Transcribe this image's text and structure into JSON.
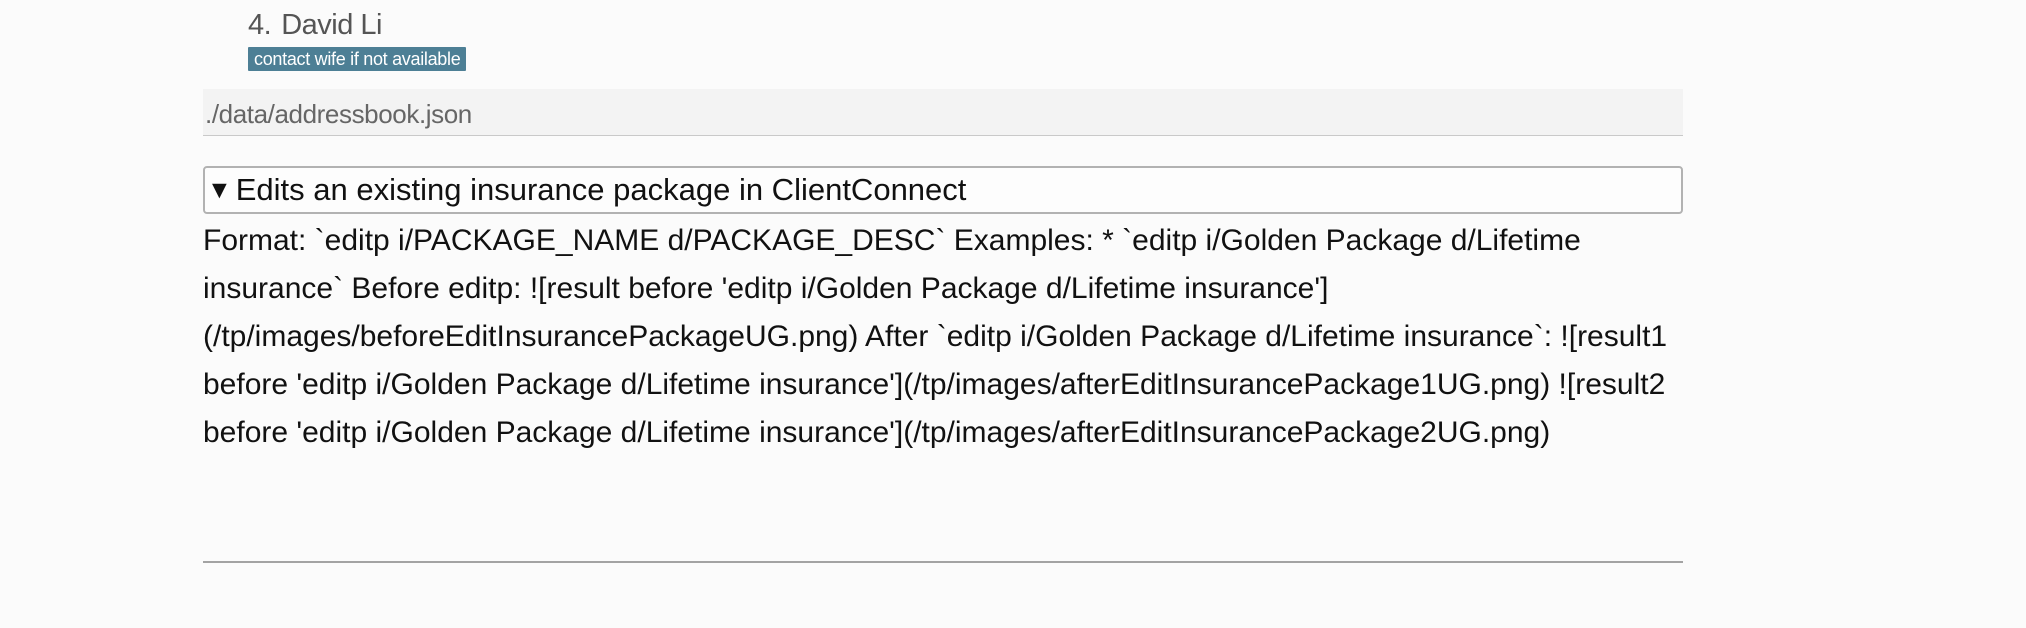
{
  "contact": {
    "number": "4.",
    "name": "David Li",
    "tag": "contact wife if not available"
  },
  "file": {
    "path": "./data/addressbook.json"
  },
  "section": {
    "toggle_icon": "▼",
    "title": "Edits an existing insurance package in ClientConnect",
    "body": "Format: `editp i/PACKAGE_NAME d/PACKAGE_DESC` Examples: * `editp i/Golden Package d/Lifetime insurance` Before editp: ![result before 'editp i/Golden Package d/Lifetime insurance'](/tp/images/beforeEditInsurancePackageUG.png) After `editp i/Golden Package d/Lifetime insurance`: ![result1 before 'editp i/Golden Package d/Lifetime insurance'](/tp/images/afterEditInsurancePackage1UG.png) ![result2 before 'editp i/Golden Package d/Lifetime insurance'](/tp/images/afterEditInsurancePackage2UG.png)"
  },
  "colors": {
    "tag_bg": "#4d7f95",
    "tag_text": "#ffffff",
    "box_border": "#b2b2b2",
    "divider": "#a3a3a3"
  }
}
